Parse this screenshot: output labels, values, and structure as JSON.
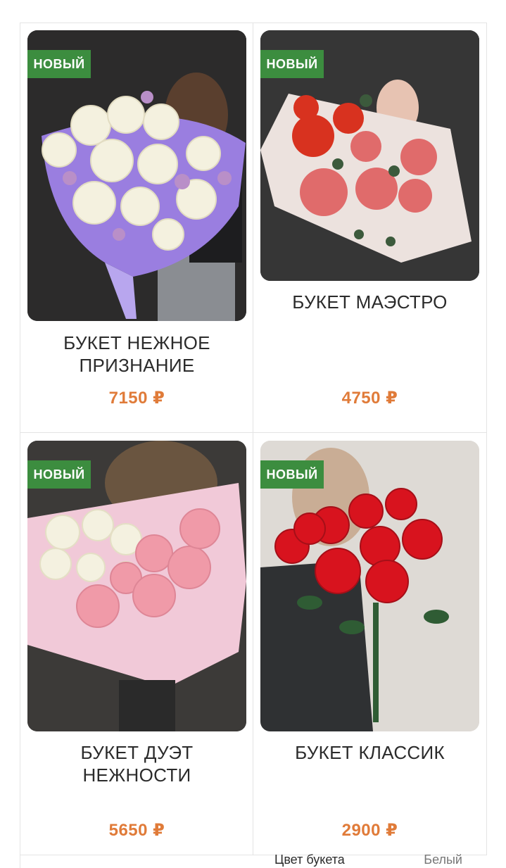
{
  "products": [
    {
      "badge": "НОВЫЙ",
      "title": "БУКЕТ НЕЖНОЕ ПРИЗНАНИЕ",
      "price": "7150 ₽"
    },
    {
      "badge": "НОВЫЙ",
      "title": "БУКЕТ МАЭСТРО",
      "price": "4750 ₽"
    },
    {
      "badge": "НОВЫЙ",
      "title": "БУКЕТ ДУЭТ НЕЖНОСТИ",
      "price": "5650 ₽"
    },
    {
      "badge": "НОВЫЙ",
      "title": "БУКЕТ КЛАССИК",
      "price": "2900 ₽",
      "option_label": "Цвет букета",
      "option_value": "Белый"
    }
  ],
  "colors": {
    "badge": "#3c8d3f",
    "price": "#e07b39",
    "title": "#2b2b2b"
  }
}
